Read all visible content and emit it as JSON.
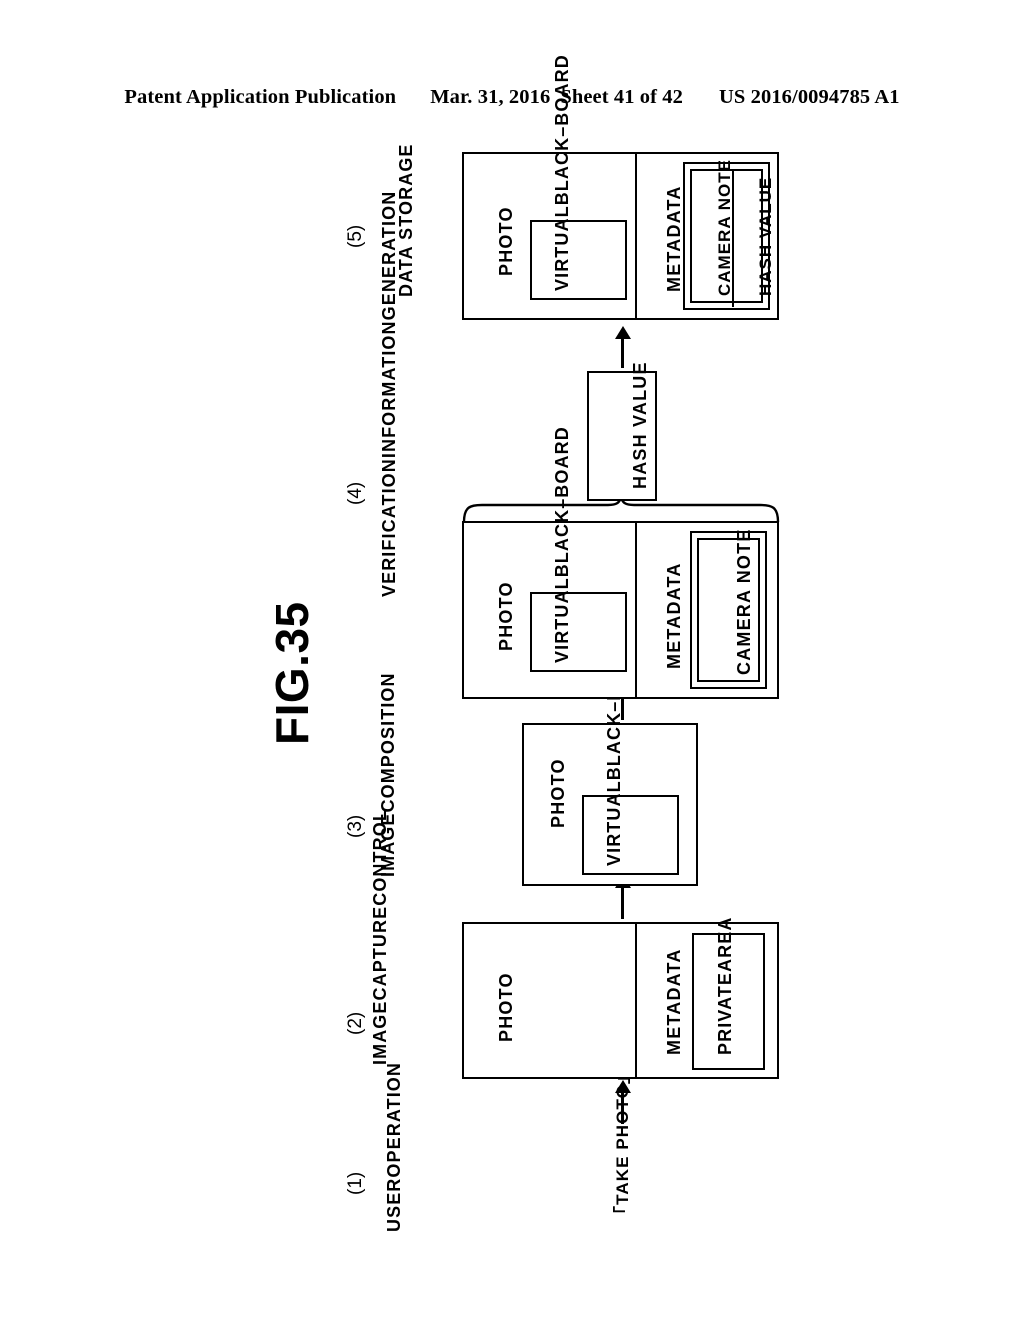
{
  "header": {
    "publication": "Patent Application Publication",
    "date": "Mar. 31, 2016",
    "sheet": "Sheet 41 of 42",
    "patent_number": "US 2016/0094785 A1"
  },
  "figure": {
    "title": "FIG.35",
    "stages": [
      {
        "number": "(1)",
        "name_lines": [
          "USER",
          "OPERATION"
        ],
        "action_label": "「TAKE PHOTO」"
      },
      {
        "number": "(2)",
        "name_lines": [
          "IMAGE",
          "CAPTURE",
          "CONTROL"
        ],
        "box": {
          "photo_label": "PHOTO",
          "metadata_label": "METADATA",
          "metadata_item": "PRIVATE\nAREA",
          "metadata_item_lines": [
            "PRIVATE",
            "AREA"
          ]
        }
      },
      {
        "number": "(3)",
        "name_lines": [
          "IMAGE",
          "COMPOSITION"
        ],
        "box": {
          "photo_label": "PHOTO",
          "photo_item_lines": [
            "VIRTUAL",
            "BLACK–",
            "BOARD"
          ]
        }
      },
      {
        "number": "(4)",
        "name_lines": [
          "VERIFICATION",
          "INFORMATION",
          "GENERATION"
        ],
        "box": {
          "photo_label": "PHOTO",
          "photo_item_lines": [
            "VIRTUAL",
            "BLACK–",
            "BOARD"
          ],
          "metadata_label": "METADATA",
          "metadata_item": "CAMERA NOTE"
        },
        "output_box": "HASH VALUE"
      },
      {
        "number": "(5)",
        "name_lines": [
          "DATA STORAGE"
        ],
        "box": {
          "photo_label": "PHOTO",
          "photo_item_lines": [
            "VIRTUAL",
            "BLACK–",
            "BOARD"
          ],
          "metadata_label": "METADATA",
          "metadata_items": [
            "CAMERA NOTE",
            "HASH VALUE"
          ]
        }
      }
    ]
  },
  "colors": {
    "ink": "#000000",
    "paper": "#ffffff"
  }
}
